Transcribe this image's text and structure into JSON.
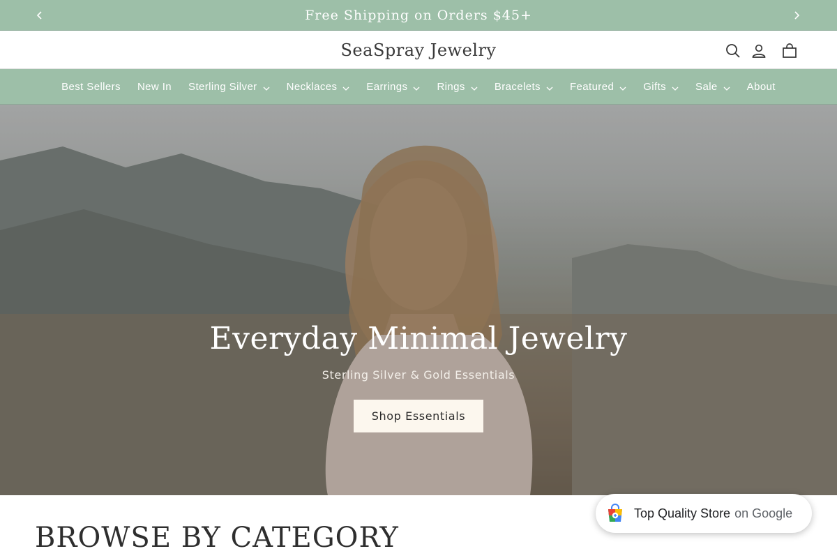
{
  "announcement": {
    "message": "Free Shipping on Orders $45+",
    "prev_icon": "chevron-left-icon",
    "next_icon": "chevron-right-icon"
  },
  "header": {
    "logo": "SeaSpray Jewelry",
    "icons": [
      "search-icon",
      "account-icon",
      "cart-icon"
    ]
  },
  "nav": {
    "items": [
      {
        "label": "Best Sellers",
        "dropdown": false
      },
      {
        "label": "New In",
        "dropdown": false
      },
      {
        "label": "Sterling Silver",
        "dropdown": true
      },
      {
        "label": "Necklaces",
        "dropdown": true
      },
      {
        "label": "Earrings",
        "dropdown": true
      },
      {
        "label": "Rings",
        "dropdown": true
      },
      {
        "label": "Bracelets",
        "dropdown": true
      },
      {
        "label": "Featured",
        "dropdown": true
      },
      {
        "label": "Gifts",
        "dropdown": true
      },
      {
        "label": "Sale",
        "dropdown": true
      },
      {
        "label": "About",
        "dropdown": false
      }
    ]
  },
  "hero": {
    "title": "Everyday Minimal Jewelry",
    "subtitle": "Sterling Silver & Gold Essentials",
    "button": "Shop Essentials"
  },
  "browse": {
    "title": "BROWSE BY CATEGORY"
  },
  "google_badge": {
    "label": "Top Quality Store",
    "suffix": "on Google"
  },
  "colors": {
    "accent": "#9dbfa8",
    "button_bg": "#fcf7ee",
    "text": "#2b2b2b"
  }
}
